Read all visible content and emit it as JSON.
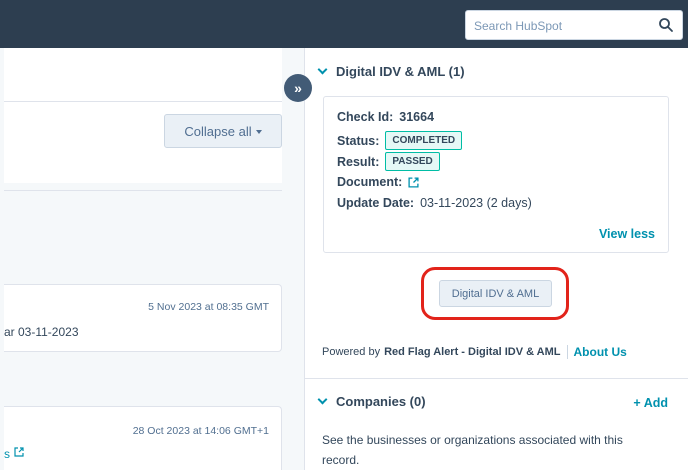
{
  "header": {
    "search_placeholder": "Search HubSpot"
  },
  "left": {
    "collapse_label": "Collapse all",
    "activity_1": {
      "timestamp": "5 Nov 2023 at 08:35 GMT",
      "text": "ar 03-11-2023"
    },
    "activity_2": {
      "timestamp": "28 Oct 2023 at 14:06 GMT+1",
      "text": "s"
    }
  },
  "idv_section": {
    "title": "Digital IDV & AML (1)",
    "check_label": "Check Id:",
    "check_id": "31664",
    "status_label": "Status:",
    "status_value": "COMPLETED",
    "result_label": "Result:",
    "result_value": "PASSED",
    "document_label": "Document:",
    "update_label": "Update Date:",
    "update_value": "03-11-2023 (2 days)",
    "view_less": "View less",
    "button_label": "Digital IDV & AML",
    "powered_prefix": "Powered by",
    "powered_brand": "Red Flag Alert - Digital IDV & AML",
    "about_label": "About Us"
  },
  "companies_section": {
    "title": "Companies (0)",
    "add_label": "+ Add",
    "description": "See the businesses or organizations associated with this record."
  },
  "colors": {
    "accent": "#0091ae",
    "topbar": "#2d3e50",
    "highlight": "#e2231a",
    "tag_border": "#00bda5"
  }
}
